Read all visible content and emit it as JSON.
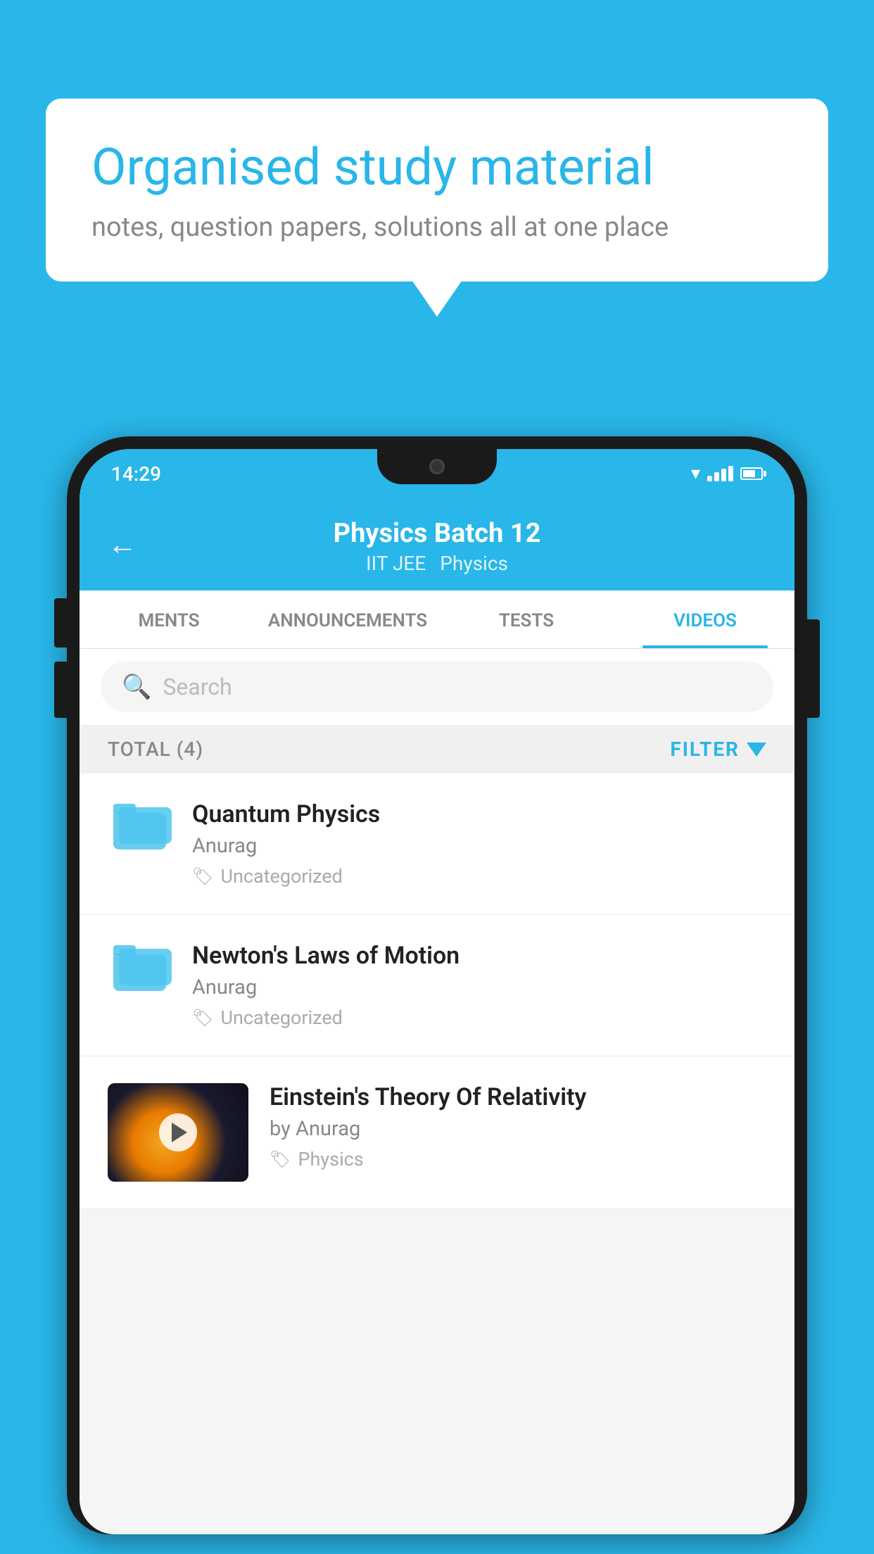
{
  "background_color": "#29b6e8",
  "speech_bubble": {
    "title": "Organised study material",
    "subtitle": "notes, question papers, solutions all at one place"
  },
  "status_bar": {
    "time": "14:29"
  },
  "app_header": {
    "back_label": "←",
    "title": "Physics Batch 12",
    "tag1": "IIT JEE",
    "tag2": "Physics"
  },
  "tabs": [
    {
      "label": "MENTS",
      "active": false
    },
    {
      "label": "ANNOUNCEMENTS",
      "active": false
    },
    {
      "label": "TESTS",
      "active": false
    },
    {
      "label": "VIDEOS",
      "active": true
    }
  ],
  "search": {
    "placeholder": "Search"
  },
  "filter_bar": {
    "total_label": "TOTAL (4)",
    "filter_label": "FILTER"
  },
  "video_items": [
    {
      "id": 1,
      "title": "Quantum Physics",
      "author": "Anurag",
      "tag": "Uncategorized",
      "has_thumb": false
    },
    {
      "id": 2,
      "title": "Newton's Laws of Motion",
      "author": "Anurag",
      "tag": "Uncategorized",
      "has_thumb": false
    },
    {
      "id": 3,
      "title": "Einstein's Theory Of Relativity",
      "author": "by Anurag",
      "tag": "Physics",
      "has_thumb": true
    }
  ]
}
